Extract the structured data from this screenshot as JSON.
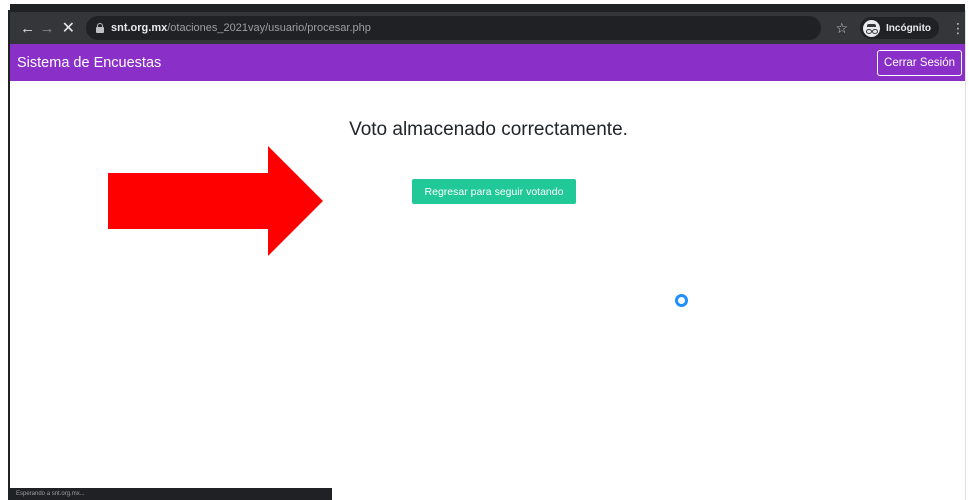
{
  "browser": {
    "url_host": "snt.org.mx",
    "url_path": "/otaciones_2021vay/usuario/procesar.php",
    "profile_label": "Incógnito",
    "status_text": "Esperando a snt.org.mx..."
  },
  "navbar": {
    "brand": "Sistema de Encuestas",
    "logout_label": "Cerrar Sesión",
    "background_color": "#8b2fc9"
  },
  "main": {
    "headline": "Voto almacenado correctamente.",
    "back_button_label": "Regresar para seguir votando",
    "back_button_color": "#20c997"
  },
  "annotation": {
    "arrow_color": "#ff0000",
    "arrow_direction": "right"
  },
  "icons": {
    "back": "arrow-left-icon",
    "forward": "arrow-right-icon",
    "stop": "close-icon",
    "lock": "lock-icon",
    "bookmark": "star-icon",
    "profile": "incognito-icon",
    "menu": "more-vert-icon",
    "cursor": "loading-cursor-icon"
  }
}
